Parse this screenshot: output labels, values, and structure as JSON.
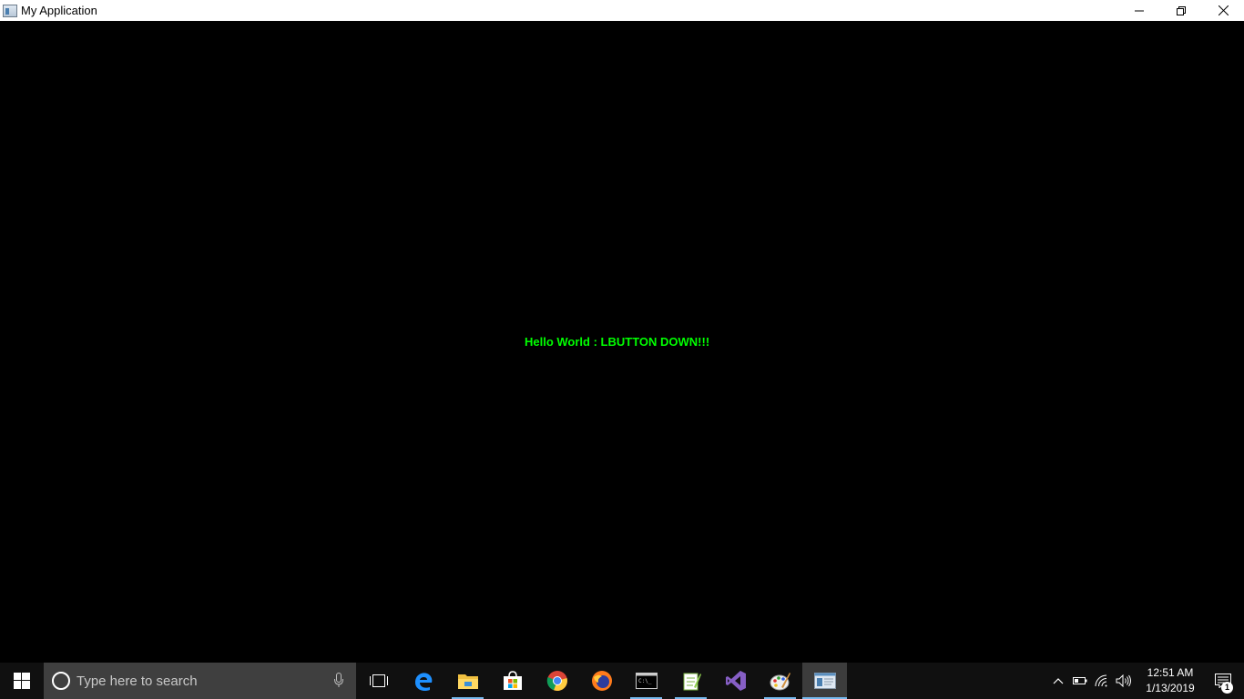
{
  "window": {
    "title": "My Application",
    "controls": [
      "minimize",
      "restore",
      "close"
    ]
  },
  "client": {
    "message": "Hello World : LBUTTON DOWN!!!",
    "message_color": "#00ff00",
    "background": "#000000"
  },
  "taskbar": {
    "search_placeholder": "Type here to search",
    "pinned": [
      {
        "name": "task-view",
        "icon": "task-view-icon",
        "running": false
      },
      {
        "name": "edge",
        "icon": "edge-icon",
        "running": false
      },
      {
        "name": "file-explorer",
        "icon": "folder-icon",
        "running": true
      },
      {
        "name": "store",
        "icon": "store-icon",
        "running": false
      },
      {
        "name": "chrome",
        "icon": "chrome-icon",
        "running": false
      },
      {
        "name": "firefox",
        "icon": "firefox-icon",
        "running": false
      },
      {
        "name": "command-prompt",
        "icon": "cmd-icon",
        "running": true
      },
      {
        "name": "notepad-plus-plus",
        "icon": "notepadpp-icon",
        "running": true
      },
      {
        "name": "visual-studio",
        "icon": "visual-studio-icon",
        "running": false
      },
      {
        "name": "paint",
        "icon": "paint-icon",
        "running": true
      },
      {
        "name": "my-application",
        "icon": "app-window-icon",
        "running": true,
        "active": true
      }
    ],
    "clock": {
      "time": "12:51 AM",
      "date": "1/13/2019"
    },
    "notifications_count": "1",
    "accent_color": "#76b9ed"
  }
}
